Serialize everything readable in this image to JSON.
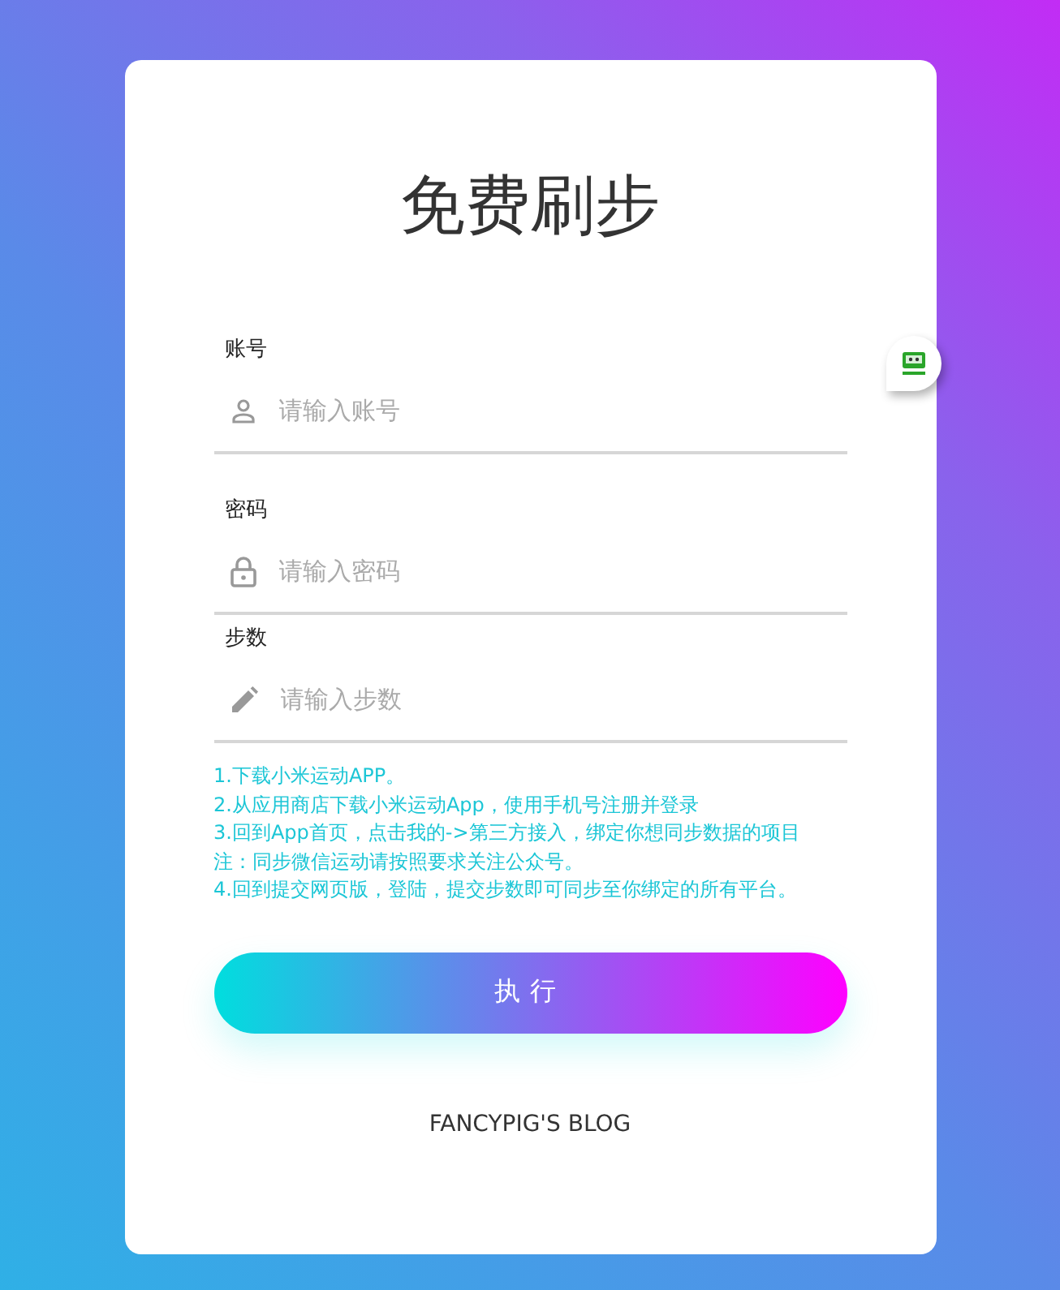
{
  "title": "免费刷步",
  "fields": [
    {
      "kind": "user",
      "label": "账号",
      "placeholder": "请输入账号"
    },
    {
      "kind": "lock",
      "label": "密码",
      "placeholder": "请输入密码"
    },
    {
      "kind": "pencil",
      "label": "步数",
      "placeholder": "请输入步数"
    }
  ],
  "instructions": [
    "1.下载小米运动APP。",
    "2.从应用商店下载小米运动App，使用手机号注册并登录",
    "3.回到App首页，点击我的->第三方接入，绑定你想同步数据的项目",
    "注：同步微信运动请按照要求关注公众号。",
    "4.回到提交网页版，登陆，提交步数即可同步至你绑定的所有平台。"
  ],
  "submit_button": "执行",
  "footer_link": "FANCYPIG'S BLOG"
}
